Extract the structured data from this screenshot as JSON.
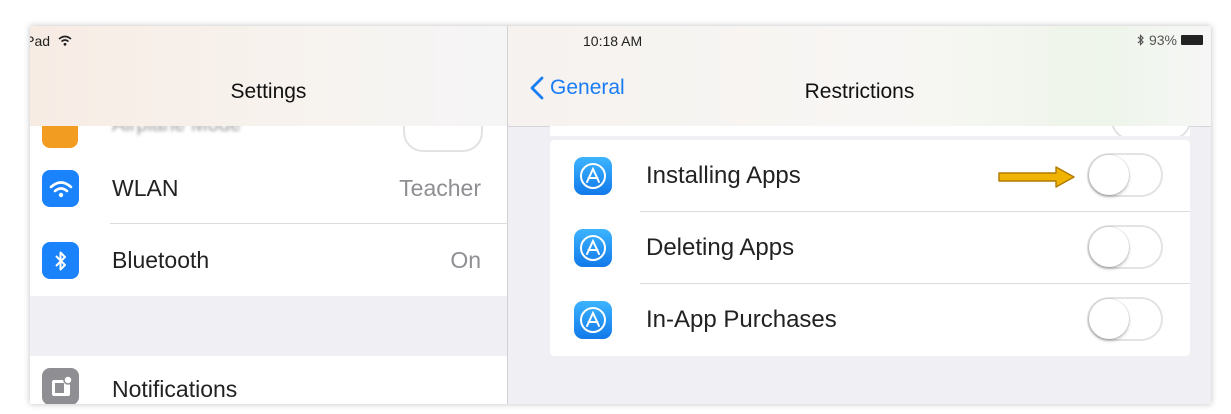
{
  "status_bar": {
    "device": "iPad",
    "time": "10:18 AM",
    "battery": "93%"
  },
  "left_pane": {
    "title": "Settings",
    "partial_row": {
      "label": "Airplane Mode",
      "icon": "airplane-icon"
    },
    "rows": [
      {
        "label": "WLAN",
        "value": "Teacher",
        "icon": "wifi-icon"
      },
      {
        "label": "Bluetooth",
        "value": "On",
        "icon": "bluetooth-icon"
      }
    ],
    "notifications": {
      "label": "Notifications",
      "icon": "notifications-icon"
    }
  },
  "right_pane": {
    "back_label": "General",
    "title": "Restrictions",
    "rows": [
      {
        "label": "Installing Apps",
        "icon": "app-store-icon",
        "enabled": false
      },
      {
        "label": "Deleting Apps",
        "icon": "app-store-icon",
        "enabled": false
      },
      {
        "label": "In-App Purchases",
        "icon": "app-store-icon",
        "enabled": false
      }
    ]
  },
  "colors": {
    "accent": "#1a7cf5",
    "arrow": "#f0b400",
    "group_bg": "#efeff4"
  }
}
